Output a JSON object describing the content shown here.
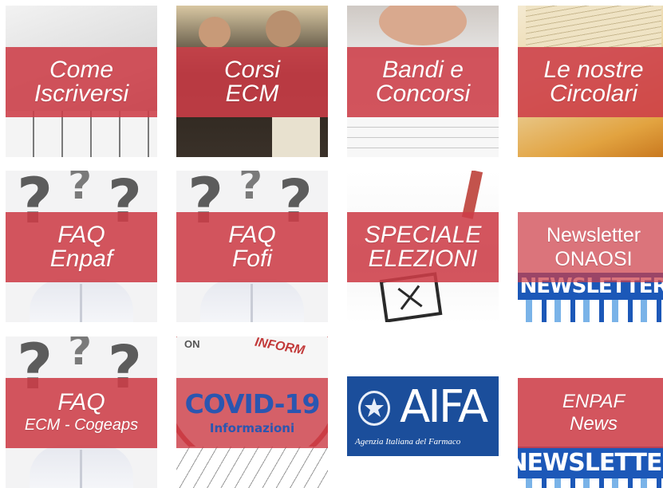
{
  "tiles": {
    "come_iscriversi": {
      "line1": "Come",
      "line2": "Iscriversi"
    },
    "corsi_ecm": {
      "line1": "Corsi",
      "line2": "ECM"
    },
    "bandi_concorsi": {
      "line1": "Bandi e",
      "line2": "Concorsi"
    },
    "circolari": {
      "line1": "Le nostre",
      "line2": "Circolari"
    },
    "faq_enpaf": {
      "line1": "FAQ",
      "line2": "Enpaf"
    },
    "faq_fofi": {
      "line1": "FAQ",
      "line2": "Fofi"
    },
    "speciale_elezioni": {
      "line1": "SPECIALE",
      "line2": "ELEZIONI"
    },
    "newsletter_onaosi": {
      "line1": "Newsletter",
      "line2": "ONAOSI",
      "image_text": "NEWSLETTER"
    },
    "faq_ecm": {
      "line1": "FAQ",
      "line2": "ECM - Cogeaps"
    },
    "covid": {
      "title": "COVID-19",
      "subtitle": "Informazioni",
      "stamp": "INFORM",
      "stamp_left": "ON"
    },
    "aifa": {
      "logo": "AIFA",
      "caption": "Agenzia Italiana del Farmaco"
    },
    "enpaf_news": {
      "line1": "ENPAF",
      "line2": "News",
      "image_text": "NEWSLETTER"
    }
  },
  "icons": {
    "question_mark": "?"
  },
  "colors": {
    "band": "#cd3e48",
    "aifa_blue": "#1b4e9b",
    "newsletter_blue": "#1c58b8",
    "covid_blue": "#2b56b0"
  }
}
